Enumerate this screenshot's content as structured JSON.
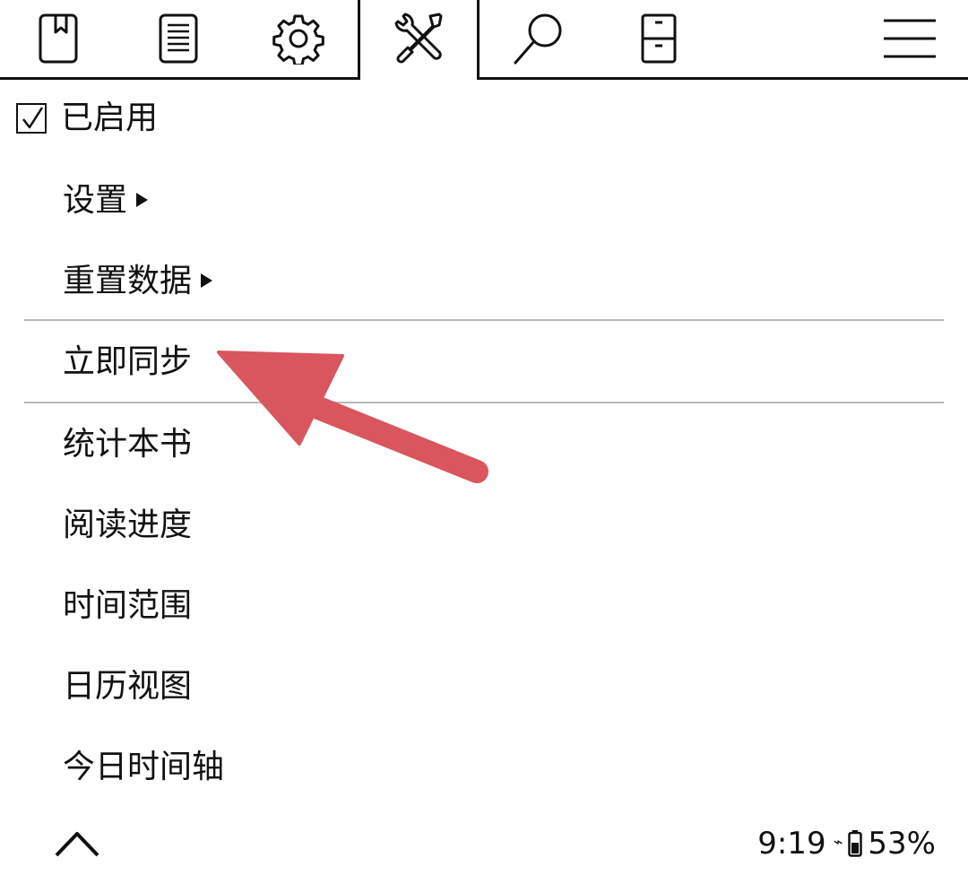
{
  "tabs": [
    {
      "name": "bookmark-tab",
      "icon": "bookmark-icon"
    },
    {
      "name": "toc-tab",
      "icon": "document-list-icon"
    },
    {
      "name": "settings-tab",
      "icon": "gear-icon"
    },
    {
      "name": "tools-tab",
      "icon": "tools-icon",
      "active": true
    },
    {
      "name": "search-tab",
      "icon": "search-icon"
    },
    {
      "name": "filemanager-tab",
      "icon": "cabinet-icon"
    },
    {
      "name": "main-menu-tab",
      "icon": "hamburger-menu-icon"
    }
  ],
  "menu": {
    "enabled_checkbox": "☑",
    "enabled_label": "已启用",
    "items": [
      {
        "label": "设置",
        "has_submenu": true
      },
      {
        "label": "重置数据",
        "has_submenu": true
      },
      {
        "label": "立即同步",
        "has_submenu": false
      },
      {
        "label": "统计本书",
        "has_submenu": false
      },
      {
        "label": "阅读进度",
        "has_submenu": false
      },
      {
        "label": "时间范围",
        "has_submenu": false
      },
      {
        "label": "日历视图",
        "has_submenu": false
      },
      {
        "label": "今日时间轴",
        "has_submenu": false
      }
    ]
  },
  "status": {
    "time": "9:19",
    "wifi_glyph": "⌁",
    "battery": "53%"
  },
  "annotation": {
    "type": "arrow",
    "color": "#d9565f",
    "points_to": "立即同步"
  },
  "colors": {
    "text": "#111111",
    "divider": "#b8b8b8",
    "background": "#ffffff"
  }
}
